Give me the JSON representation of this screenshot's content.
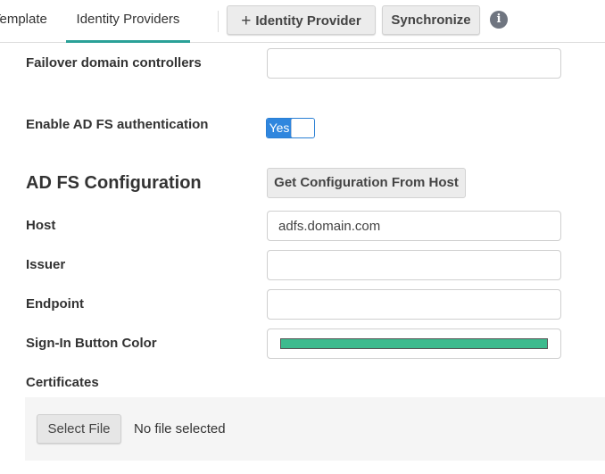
{
  "toolbar": {
    "tab_template_label": "Template",
    "tab_identity_providers_label": "Identity Providers",
    "add_identity_provider_label": "Identity Provider",
    "add_icon_glyph": "+",
    "synchronize_label": "Synchronize",
    "info_glyph": "i",
    "active_tab": "Identity Providers",
    "accent_color": "#2aa198"
  },
  "form": {
    "failover_label": "Failover domain controllers",
    "failover_value": "",
    "enable_adfs_label": "Enable AD FS authentication",
    "enable_adfs_toggle_text": "Yes",
    "enable_adfs_enabled": true,
    "adfs_section_title": "AD FS Configuration",
    "get_config_label": "Get Configuration From Host",
    "host_label": "Host",
    "host_value": "adfs.domain.com",
    "issuer_label": "Issuer",
    "issuer_value": "",
    "endpoint_label": "Endpoint",
    "endpoint_value": "",
    "signin_color_label": "Sign-In Button Color",
    "signin_color_value": "#3dbb8e",
    "certificates_label": "Certificates",
    "select_file_label": "Select File",
    "file_status": "No file selected"
  }
}
